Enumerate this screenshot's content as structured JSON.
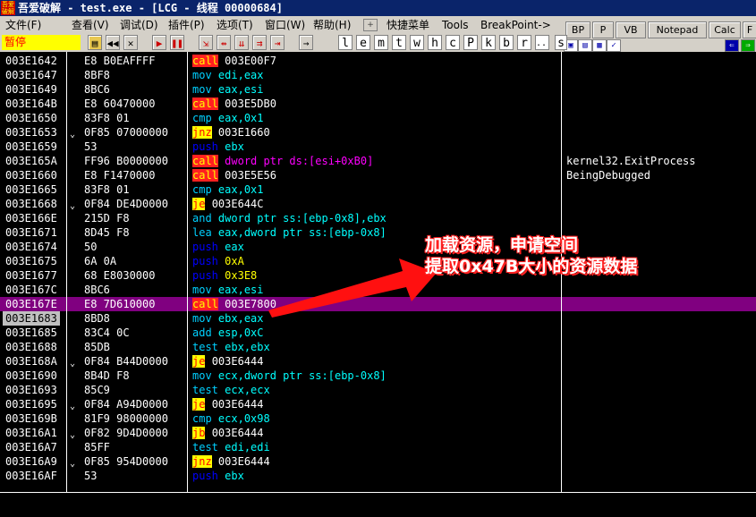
{
  "window": {
    "title": "吾爱破解 - test.exe - [LCG -  线程  00000684]",
    "logo_text": "吾爱\n破解"
  },
  "menu": {
    "items": [
      "文件(F)",
      "查看(V)",
      "调试(D)",
      "插件(P)",
      "选项(T)",
      "窗口(W)",
      "帮助(H)",
      "快捷菜单",
      "Tools",
      "BreakPoint->"
    ]
  },
  "toolbar": {
    "status": "暂停",
    "letters": [
      "l",
      "e",
      "m",
      "t",
      "w",
      "h",
      "c",
      "P",
      "k",
      "b",
      "r",
      "...",
      "s"
    ]
  },
  "right_panel": {
    "buttons": [
      "BP",
      "P",
      "VB",
      "Notepad",
      "Calc",
      "F"
    ]
  },
  "disasm": {
    "rows": [
      {
        "addr": "003E1642",
        "j": "",
        "hex": "E8 B0EAFFFF",
        "mn": "call",
        "op": "003E00F7",
        "cls": "m-call",
        "opcls": "",
        "cmt": ""
      },
      {
        "addr": "003E1647",
        "j": "",
        "hex": "8BF8",
        "mn": "mov",
        "op": "edi,eax",
        "cls": "m-mov",
        "opcls": "op-reg",
        "cmt": ""
      },
      {
        "addr": "003E1649",
        "j": "",
        "hex": "8BC6",
        "mn": "mov",
        "op": "eax,esi",
        "cls": "m-mov",
        "opcls": "op-reg",
        "cmt": ""
      },
      {
        "addr": "003E164B",
        "j": "",
        "hex": "E8 60470000",
        "mn": "call",
        "op": "003E5DB0",
        "cls": "m-call",
        "opcls": "",
        "cmt": ""
      },
      {
        "addr": "003E1650",
        "j": "",
        "hex": "83F8 01",
        "mn": "cmp",
        "op": "eax,0x1",
        "cls": "m-cmp",
        "opcls": "op-reg",
        "cmt": ""
      },
      {
        "addr": "003E1653",
        "j": "⌄",
        "hex": "0F85 07000000",
        "mn": "jnz",
        "op": "003E1660",
        "cls": "m-jmp",
        "opcls": "",
        "cmt": ""
      },
      {
        "addr": "003E1659",
        "j": "",
        "hex": "53",
        "mn": "push",
        "op": "ebx",
        "cls": "m-push",
        "opcls": "op-reg",
        "cmt": ""
      },
      {
        "addr": "003E165A",
        "j": "",
        "hex": "FF96 B0000000",
        "mn": "call",
        "op": "dword ptr ds:[esi+0xB0]",
        "cls": "m-call",
        "opcls": "op-mem",
        "cmt": "kernel32.ExitProcess"
      },
      {
        "addr": "003E1660",
        "j": "",
        "hex": "E8 F1470000",
        "mn": "call",
        "op": "003E5E56",
        "cls": "m-call",
        "opcls": "",
        "cmt": "BeingDebugged"
      },
      {
        "addr": "003E1665",
        "j": "",
        "hex": "83F8 01",
        "mn": "cmp",
        "op": "eax,0x1",
        "cls": "m-cmp",
        "opcls": "op-reg",
        "cmt": ""
      },
      {
        "addr": "003E1668",
        "j": "⌄",
        "hex": "0F84 DE4D0000",
        "mn": "je",
        "op": "003E644C",
        "cls": "m-jmp",
        "opcls": "",
        "cmt": ""
      },
      {
        "addr": "003E166E",
        "j": "",
        "hex": "215D F8",
        "mn": "and",
        "op": "dword ptr ss:[ebp-0x8],ebx",
        "cls": "m-and",
        "opcls": "op-reg",
        "cmt": ""
      },
      {
        "addr": "003E1671",
        "j": "",
        "hex": "8D45 F8",
        "mn": "lea",
        "op": "eax,dword ptr ss:[ebp-0x8]",
        "cls": "m-lea",
        "opcls": "op-reg",
        "cmt": ""
      },
      {
        "addr": "003E1674",
        "j": "",
        "hex": "50",
        "mn": "push",
        "op": "eax",
        "cls": "m-push",
        "opcls": "op-reg",
        "cmt": ""
      },
      {
        "addr": "003E1675",
        "j": "",
        "hex": "6A 0A",
        "mn": "push",
        "op": "0xA",
        "cls": "m-push",
        "opcls": "op-num",
        "cmt": ""
      },
      {
        "addr": "003E1677",
        "j": "",
        "hex": "68 E8030000",
        "mn": "push",
        "op": "0x3E8",
        "cls": "m-push",
        "opcls": "op-num",
        "cmt": ""
      },
      {
        "addr": "003E167C",
        "j": "",
        "hex": "8BC6",
        "mn": "mov",
        "op": "eax,esi",
        "cls": "m-mov",
        "opcls": "op-reg",
        "cmt": ""
      },
      {
        "addr": "003E167E",
        "j": "",
        "hex": "E8 7D610000",
        "mn": "call",
        "op": "003E7800",
        "cls": "m-call",
        "opcls": "",
        "cmt": "",
        "sel": true
      },
      {
        "addr": "003E1683",
        "j": "",
        "hex": "8BD8",
        "mn": "mov",
        "op": "ebx,eax",
        "cls": "m-mov",
        "opcls": "op-reg",
        "cmt": "",
        "cur": true
      },
      {
        "addr": "003E1685",
        "j": "",
        "hex": "83C4 0C",
        "mn": "add",
        "op": "esp,0xC",
        "cls": "m-add",
        "opcls": "op-reg",
        "cmt": ""
      },
      {
        "addr": "003E1688",
        "j": "",
        "hex": "85DB",
        "mn": "test",
        "op": "ebx,ebx",
        "cls": "m-test",
        "opcls": "op-reg",
        "cmt": ""
      },
      {
        "addr": "003E168A",
        "j": "⌄",
        "hex": "0F84 B44D0000",
        "mn": "je",
        "op": "003E6444",
        "cls": "m-jmp",
        "opcls": "",
        "cmt": ""
      },
      {
        "addr": "003E1690",
        "j": "",
        "hex": "8B4D F8",
        "mn": "mov",
        "op": "ecx,dword ptr ss:[ebp-0x8]",
        "cls": "m-mov",
        "opcls": "op-reg",
        "cmt": ""
      },
      {
        "addr": "003E1693",
        "j": "",
        "hex": "85C9",
        "mn": "test",
        "op": "ecx,ecx",
        "cls": "m-test",
        "opcls": "op-reg",
        "cmt": ""
      },
      {
        "addr": "003E1695",
        "j": "⌄",
        "hex": "0F84 A94D0000",
        "mn": "je",
        "op": "003E6444",
        "cls": "m-jmp",
        "opcls": "",
        "cmt": ""
      },
      {
        "addr": "003E169B",
        "j": "",
        "hex": "81F9 98000000",
        "mn": "cmp",
        "op": "ecx,0x98",
        "cls": "m-cmp",
        "opcls": "op-reg",
        "cmt": ""
      },
      {
        "addr": "003E16A1",
        "j": "⌄",
        "hex": "0F82 9D4D0000",
        "mn": "jb",
        "op": "003E6444",
        "cls": "m-jmp",
        "opcls": "",
        "cmt": ""
      },
      {
        "addr": "003E16A7",
        "j": "",
        "hex": "85FF",
        "mn": "test",
        "op": "edi,edi",
        "cls": "m-test",
        "opcls": "op-reg",
        "cmt": ""
      },
      {
        "addr": "003E16A9",
        "j": "⌄",
        "hex": "0F85 954D0000",
        "mn": "jnz",
        "op": "003E6444",
        "cls": "m-jmp",
        "opcls": "",
        "cmt": ""
      },
      {
        "addr": "003E16AF",
        "j": "",
        "hex": "53",
        "mn": "push",
        "op": "ebx",
        "cls": "m-push",
        "opcls": "op-reg",
        "cmt": ""
      }
    ]
  },
  "annotation": {
    "line1": "加载资源，申请空间",
    "line2": "提取0x47B大小的资源数据"
  },
  "colors": {
    "selected_row": "#800080",
    "call_bg": "#ff2020",
    "jump_bg": "#ffff00",
    "annotation_outline": "#ff2020"
  }
}
